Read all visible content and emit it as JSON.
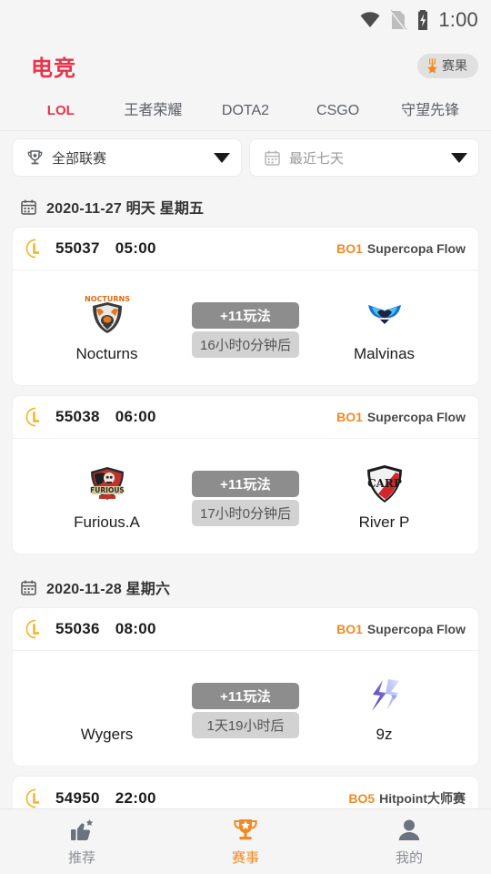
{
  "statusbar": {
    "time": "1:00",
    "icons": [
      "wifi-icon",
      "sim-card-off-icon",
      "battery-charging-icon"
    ]
  },
  "header": {
    "title": "电竞",
    "result_badge": {
      "label": "赛果",
      "icon": "medal-icon"
    },
    "accent_red": "#e8334a",
    "accent_orange": "#f08a24"
  },
  "tabs": [
    {
      "label": "LOL",
      "active": true
    },
    {
      "label": "王者荣耀",
      "active": false
    },
    {
      "label": "DOTA2",
      "active": false
    },
    {
      "label": "CSGO",
      "active": false
    },
    {
      "label": "守望先锋",
      "active": false
    }
  ],
  "filters": {
    "league": {
      "icon": "trophy-icon",
      "value": "全部联赛",
      "muted": false
    },
    "date": {
      "icon": "calendar-icon",
      "value": "最近七天",
      "muted": true
    }
  },
  "sections": [
    {
      "date_label": "2020-11-27 明天 星期五",
      "matches": [
        {
          "id": "55037",
          "time": "05:00",
          "bo": "BO1",
          "league": "Supercopa Flow",
          "home": {
            "name": "Nocturns",
            "logo": "nocturns-bear-crest"
          },
          "away": {
            "name": "Malvinas",
            "logo": "malvinas-blue-wings"
          },
          "play_label": "+11玩法",
          "countdown": "16小时0分钟后"
        },
        {
          "id": "55038",
          "time": "06:00",
          "bo": "BO1",
          "league": "Supercopa Flow",
          "home": {
            "name": "Furious.A",
            "logo": "furious-red-crest"
          },
          "away": {
            "name": "River P",
            "logo": "river-plate-shield"
          },
          "play_label": "+11玩法",
          "countdown": "17小时0分钟后"
        }
      ]
    },
    {
      "date_label": "2020-11-28 星期六",
      "matches": [
        {
          "id": "55036",
          "time": "08:00",
          "bo": "BO1",
          "league": "Supercopa Flow",
          "home": {
            "name": "Wygers",
            "logo": ""
          },
          "away": {
            "name": "9z",
            "logo": "9z-purple-bolt"
          },
          "play_label": "+11玩法",
          "countdown": "1天19小时后"
        },
        {
          "id": "54950",
          "time": "22:00",
          "bo": "BO5",
          "league": "Hitpoint大师赛",
          "home": {
            "name": "",
            "logo": ""
          },
          "away": {
            "name": "",
            "logo": ""
          },
          "play_label": "",
          "countdown": "",
          "clipped": true
        }
      ]
    }
  ],
  "bottom_nav": [
    {
      "label": "推荐",
      "icon": "thumbs-up-star-icon",
      "active": false
    },
    {
      "label": "赛事",
      "icon": "trophy-star-icon",
      "active": true
    },
    {
      "label": "我的",
      "icon": "person-icon",
      "active": false
    }
  ]
}
